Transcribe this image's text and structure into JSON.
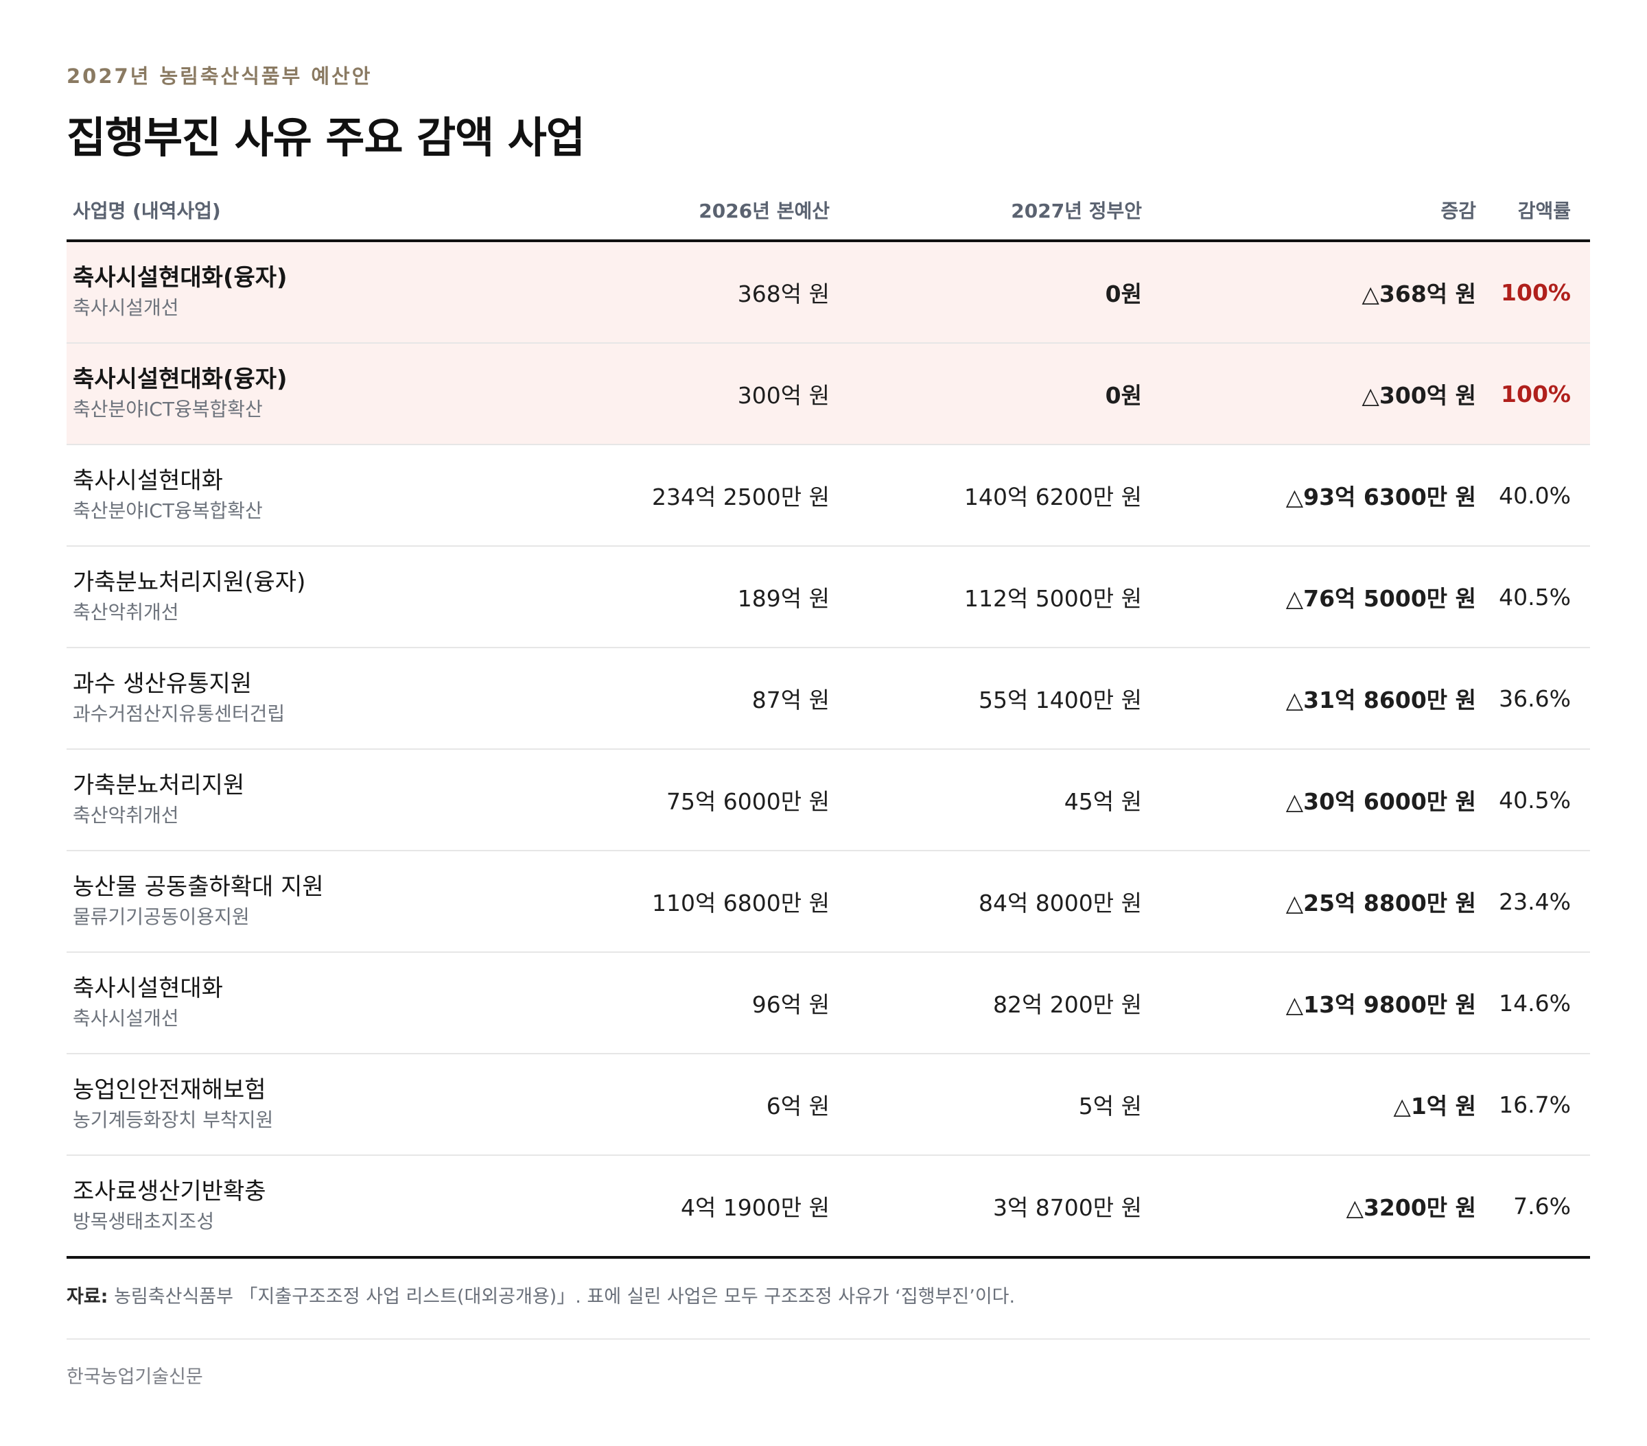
{
  "header": {
    "eyebrow": "2027년 농림축산식품부 예산안",
    "title": "집행부진 사유 주요 감액 사업"
  },
  "table": {
    "columns": [
      "사업명 (내역사업)",
      "2026년 본예산",
      "2027년 정부안",
      "증감",
      "감액률"
    ],
    "rows": [
      {
        "name": "축사시설현대화(융자)",
        "sub": "축사시설개선",
        "budget_2026": "368억 원",
        "proposal_2027": "0원",
        "change": "△368억 원",
        "rate": "100%",
        "highlight": true
      },
      {
        "name": "축사시설현대화(융자)",
        "sub": "축산분야ICT융복합확산",
        "budget_2026": "300억 원",
        "proposal_2027": "0원",
        "change": "△300억 원",
        "rate": "100%",
        "highlight": true
      },
      {
        "name": "축사시설현대화",
        "sub": "축산분야ICT융복합확산",
        "budget_2026": "234억 2500만 원",
        "proposal_2027": "140억 6200만 원",
        "change": "△93억 6300만 원",
        "rate": "40.0%",
        "highlight": false
      },
      {
        "name": "가축분뇨처리지원(융자)",
        "sub": "축산악취개선",
        "budget_2026": "189억 원",
        "proposal_2027": "112억 5000만 원",
        "change": "△76억 5000만 원",
        "rate": "40.5%",
        "highlight": false
      },
      {
        "name": "과수 생산유통지원",
        "sub": "과수거점산지유통센터건립",
        "budget_2026": "87억 원",
        "proposal_2027": "55억 1400만 원",
        "change": "△31억 8600만 원",
        "rate": "36.6%",
        "highlight": false
      },
      {
        "name": "가축분뇨처리지원",
        "sub": "축산악취개선",
        "budget_2026": "75억 6000만 원",
        "proposal_2027": "45억 원",
        "change": "△30억 6000만 원",
        "rate": "40.5%",
        "highlight": false
      },
      {
        "name": "농산물 공동출하확대 지원",
        "sub": "물류기기공동이용지원",
        "budget_2026": "110억 6800만 원",
        "proposal_2027": "84억 8000만 원",
        "change": "△25억 8800만 원",
        "rate": "23.4%",
        "highlight": false
      },
      {
        "name": "축사시설현대화",
        "sub": "축사시설개선",
        "budget_2026": "96억 원",
        "proposal_2027": "82억 200만 원",
        "change": "△13억 9800만 원",
        "rate": "14.6%",
        "highlight": false
      },
      {
        "name": "농업인안전재해보험",
        "sub": "농기계등화장치 부착지원",
        "budget_2026": "6억 원",
        "proposal_2027": "5억 원",
        "change": "△1억 원",
        "rate": "16.7%",
        "highlight": false
      },
      {
        "name": "조사료생산기반확충",
        "sub": "방목생태초지조성",
        "budget_2026": "4억 1900만 원",
        "proposal_2027": "3억 8700만 원",
        "change": "△3200만 원",
        "rate": "7.6%",
        "highlight": false
      }
    ]
  },
  "footer": {
    "source_label": "자료:",
    "source_text": "농림축산식품부 「지출구조조정 사업 리스트(대외공개용)」. 표에 실린 사업은 모두 구조조정 사유가 ‘집행부진’이다.",
    "publisher": "한국농업기술신문"
  },
  "colors": {
    "accent_red": "#b0201c",
    "highlight_bg": "#fdf1ef",
    "eyebrow": "#8a7a62"
  }
}
